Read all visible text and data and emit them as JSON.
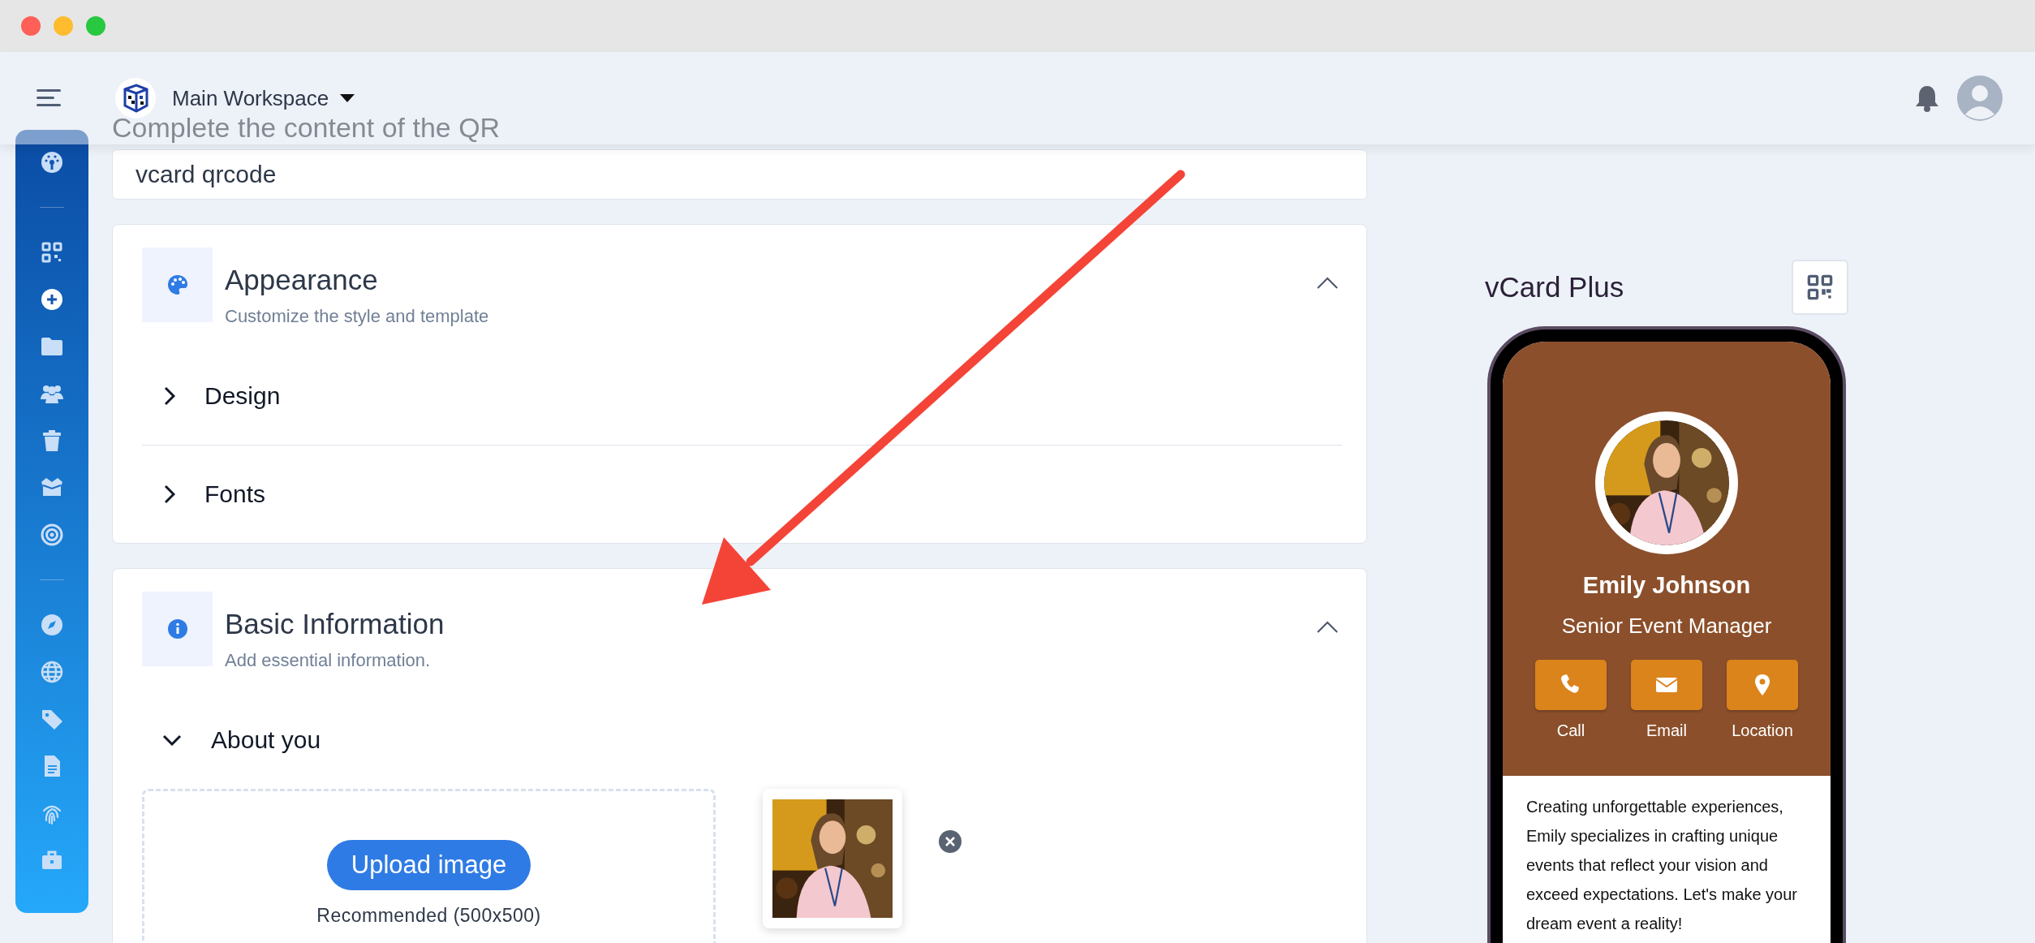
{
  "header": {
    "workspace": "Main Workspace"
  },
  "page_title": "Complete the content of the QR",
  "name_field": {
    "value": "vcard qrcode"
  },
  "sections": [
    {
      "title": "Appearance",
      "subtitle": "Customize the style and template",
      "expanded": true,
      "items": [
        {
          "label": "Design",
          "expanded": false
        },
        {
          "label": "Fonts",
          "expanded": false
        }
      ]
    },
    {
      "title": "Basic Information",
      "subtitle": "Add essential information.",
      "expanded": true,
      "items": [
        {
          "label": "About you",
          "expanded": true,
          "upload": {
            "button": "Upload image",
            "hint": "Recommended (500x500)",
            "has_image": true
          }
        }
      ]
    }
  ],
  "preview": {
    "title": "vCard Plus",
    "name": "Emily Johnson",
    "job": "Senior Event Manager",
    "actions": [
      {
        "label": "Call"
      },
      {
        "label": "Email"
      },
      {
        "label": "Location"
      }
    ],
    "bio": "Creating unforgettable experiences, Emily specializes in crafting unique events that reflect your vision and exceed expectations. Let's make your dream event a reality!"
  }
}
